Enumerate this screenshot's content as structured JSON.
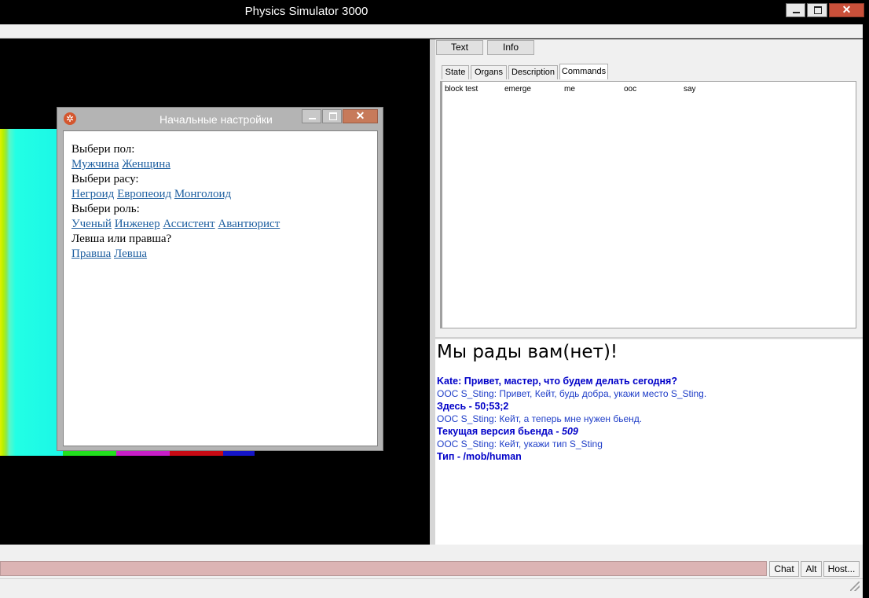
{
  "window": {
    "title": "Physics Simulator 3000",
    "close_label": "✕"
  },
  "toolbar": {
    "text_button": "Text",
    "info_button": "Info"
  },
  "tabs": [
    {
      "label": "State",
      "active": false
    },
    {
      "label": "Organs",
      "active": false
    },
    {
      "label": "Description",
      "active": false
    },
    {
      "label": "Commands",
      "active": true
    }
  ],
  "commands": [
    "block test",
    "emerge",
    "me",
    "ooc",
    "say"
  ],
  "chat": {
    "title": "Мы рады вам(нет)!",
    "lines": [
      "Kate: Привет, мастер, что будем делать сегодня?",
      "OOC S_Sting: Привет, Кейт, будь добра, укажи место S_Sting.",
      "Здесь - 50;53;2",
      "OOC S_Sting: Кейт, а теперь мне нужен бьенд.",
      "Текущая версия бьенда - ",
      "OOC S_Sting: Кейт, укажи тип S_Sting",
      "Тип - /mob/human"
    ],
    "version_value": "509"
  },
  "bottom": {
    "chat_button": "Chat",
    "alt_button": "Alt",
    "host_button": "Host..."
  },
  "dialog": {
    "title": "Начальные настройки",
    "close_label": "✕",
    "gender_prompt": "Выбери пол:",
    "genders": [
      "Мужчина",
      "Женщина"
    ],
    "race_prompt": "Выбери расу:",
    "races": [
      "Негроид",
      "Европеоид",
      "Монголоид"
    ],
    "role_prompt": "Выбери роль:",
    "roles": [
      "Ученый",
      "Инженер",
      "Ассистент",
      "Авантюрист"
    ],
    "hand_prompt": "Левша или правша?",
    "hands": [
      "Правша",
      "Левша"
    ]
  },
  "colors": {
    "chat_bold": "#0000c8",
    "chat_ooc": "#1f3ec8",
    "input_bar": "#dcb4b4",
    "link": "#1e5fa0",
    "tile_cyan": "#1bf6e6"
  }
}
